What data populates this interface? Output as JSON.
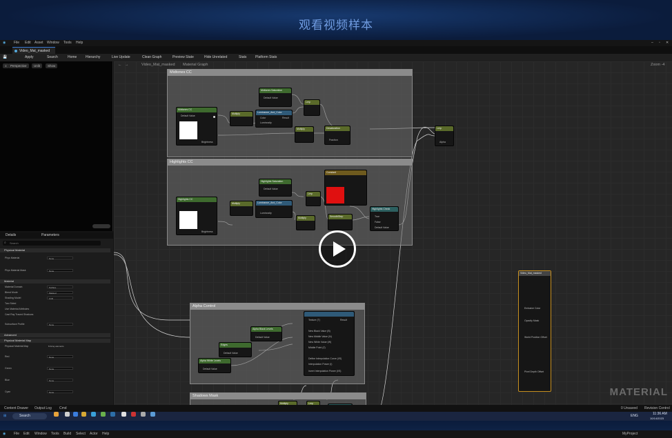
{
  "banner": {
    "title": "观看视频样本"
  },
  "menubar": {
    "items": [
      "File",
      "Edit",
      "Asset",
      "Window",
      "Tools",
      "Help"
    ]
  },
  "tab": {
    "title": "Video_Mat_masked"
  },
  "toolbar": {
    "items": [
      "Save",
      "Apply",
      "Search",
      "Home",
      "Hierarchy",
      "Live Update",
      "Clean Graph",
      "Preview State",
      "Hide Unrelated",
      "Stats",
      "Platform Stats"
    ]
  },
  "viewport": {
    "buttons": [
      "Perspective",
      "Unlit",
      "Show"
    ]
  },
  "details": {
    "tabs": [
      "Details",
      "Parameters"
    ],
    "search_placeholder": "Search",
    "sections": [
      "Physical Material",
      "Material",
      "Advanced",
      "Physical Material Map"
    ],
    "props": [
      {
        "label": "Phys Material",
        "value": "None"
      },
      {
        "label": "Phys Material Mask",
        "value": "None"
      },
      {
        "label": "Material Domain",
        "value": "Surface"
      },
      {
        "label": "Blend Mode",
        "value": "Masked"
      },
      {
        "label": "Shading Model",
        "value": "Unlit"
      },
      {
        "label": "Two Sided",
        "value": ""
      },
      {
        "label": "Use Material Attributes",
        "value": ""
      },
      {
        "label": "Cast Ray Traced Shadows",
        "value": ""
      },
      {
        "label": "Subsurface Profile",
        "value": "None"
      },
      {
        "label": "Physical Material Map",
        "value": "8 Array elements"
      },
      {
        "label": "Red",
        "value": "None"
      },
      {
        "label": "Green",
        "value": "None"
      },
      {
        "label": "Blue",
        "value": "None"
      },
      {
        "label": "Cyan",
        "value": "None"
      }
    ]
  },
  "graph": {
    "breadcrumb": [
      "Video_Mat_masked",
      "Material Graph"
    ],
    "zoom": "Zoom -4",
    "comments": [
      "Midtones CC",
      "Highlights CC",
      "Alpha Control",
      "Shadows Mask"
    ],
    "nodes": {
      "midtones_color": "Midtones CC",
      "midtones_saturation": "Midtones Saturation",
      "multiply": "Multiply",
      "luminance": "Luminance_And_Color",
      "lerp": "Lerp",
      "desaturation": "Desaturation",
      "highlights_color": "Highlights CC",
      "highlights_saturation": "Highlights Saturation",
      "highlights_check": "Highlights Check",
      "constant": "Constant",
      "smoothstep": "SmoothStep",
      "alpha_black": "Alpha Black Levels",
      "alpha_white": "Alpha White Levels",
      "edges": "Edges",
      "shadows_threshold": "Shadows Threshold",
      "pow": "Power",
      "material_output": "Video_Mat_masked"
    },
    "pins": {
      "default_value": "Default Value",
      "brightness": "Brightness",
      "color": "Color",
      "result": "Result",
      "luminosity": "Luminosity",
      "fraction": "Fraction",
      "alpha": "Alpha",
      "true": "True",
      "false": "False",
      "texture": "Texture (T)",
      "emissive": "Emissive Color",
      "opacity_mask": "Opacity Mask",
      "world_pos": "World Position Offset",
      "pixel_depth": "Pixel Depth Offset",
      "ws_inputs": [
        "New Black Value (B)",
        "New Middle Value (N)",
        "New White Value (W)",
        "Middle Point (Z)",
        "Define Interpolation Curve (I/S)",
        "Interpolation Power (I)",
        "Invert Interpolation Power (I/S)"
      ]
    },
    "watermark": "MATERIAL"
  },
  "status": {
    "items": [
      "Content Drawer",
      "Output Log",
      "Cmd",
      "0 Unsaved",
      "Revision Control"
    ]
  },
  "taskbar": {
    "search": "Search",
    "lang": "ENG",
    "time": "11:36 AM",
    "date": "10/14/2023"
  },
  "bottom_menu": {
    "items": [
      "File",
      "Edit",
      "Window",
      "Tools",
      "Build",
      "Select",
      "Actor",
      "Help"
    ],
    "project": "MyProject"
  },
  "colors": {
    "accent": "#3a7bd5",
    "highlight_red": "#e01010",
    "graph_bg": "#262626",
    "banner": "#0e2244"
  }
}
